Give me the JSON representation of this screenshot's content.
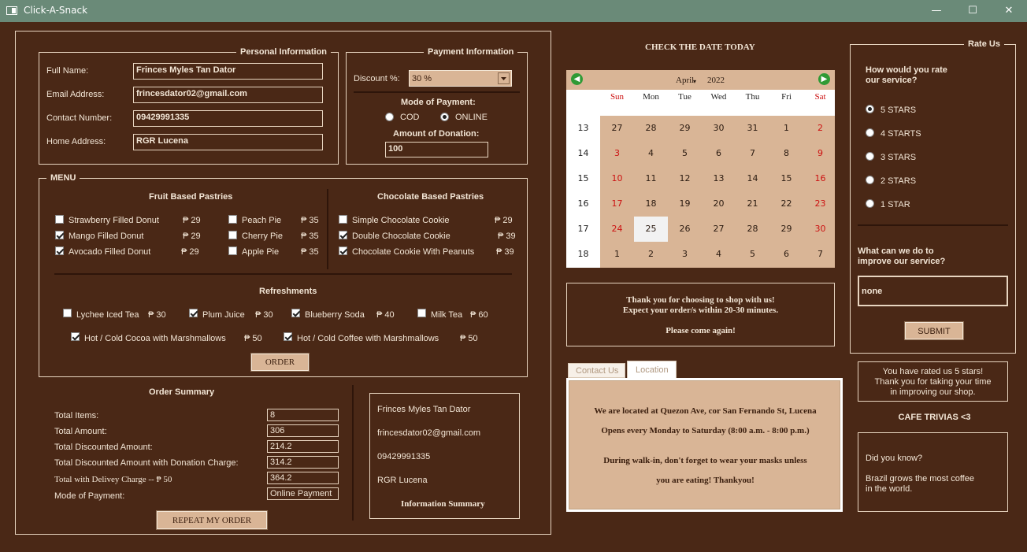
{
  "window": {
    "title": "Click-A-Snack",
    "minimize": "—",
    "maximize": "☐",
    "close": "✕"
  },
  "personal": {
    "legend": "Personal Information",
    "full_name_label": "Full Name:",
    "full_name": "Frinces Myles Tan Dator",
    "email_label": "Email Address:",
    "email": "frincesdator02@gmail.com",
    "contact_label": "Contact Number:",
    "contact": "09429991335",
    "address_label": "Home Address:",
    "address": "RGR Lucena"
  },
  "payment": {
    "legend": "Payment Information",
    "discount_label": "Discount %:",
    "discount_value": "30 %",
    "mode_label": "Mode of Payment:",
    "cod_label": "COD",
    "online_label": "ONLINE",
    "selected": "ONLINE",
    "donation_label": "Amount of Donation:",
    "donation_value": "100"
  },
  "menu": {
    "legend": "MENU",
    "currency": "₱",
    "fruit": {
      "title": "Fruit Based Pastries",
      "items": [
        {
          "name": "Strawberry Filled Donut",
          "price": "₱ 29",
          "checked": false
        },
        {
          "name": "Mango Filled Donut",
          "price": "₱ 29",
          "checked": true
        },
        {
          "name": "Avocado Filled Donut",
          "price": "₱ 29",
          "checked": true
        },
        {
          "name": "Peach Pie",
          "price": "₱ 35",
          "checked": false
        },
        {
          "name": "Cherry Pie",
          "price": "₱ 35",
          "checked": false
        },
        {
          "name": "Apple Pie",
          "price": "₱ 35",
          "checked": false
        }
      ]
    },
    "chocolate": {
      "title": "Chocolate Based Pastries",
      "items": [
        {
          "name": "Simple Chocolate Cookie",
          "price": "₱ 29",
          "checked": false
        },
        {
          "name": "Double Chocolate Cookie",
          "price": "₱ 39",
          "checked": true
        },
        {
          "name": "Chocolate Cookie With Peanuts",
          "price": "₱ 39",
          "checked": true
        }
      ]
    },
    "refreshments": {
      "title": "Refreshments",
      "items": [
        {
          "name": "Lychee Iced Tea",
          "price": "₱ 30",
          "checked": false
        },
        {
          "name": "Plum Juice",
          "price": "₱ 30",
          "checked": true
        },
        {
          "name": "Blueberry Soda",
          "price": "₱ 40",
          "checked": true
        },
        {
          "name": "Milk Tea",
          "price": "₱ 60",
          "checked": false
        },
        {
          "name": "Hot / Cold Cocoa with Marshmallows",
          "price": "₱ 50",
          "checked": true
        },
        {
          "name": "Hot / Cold Coffee with Marshmallows",
          "price": "₱ 50",
          "checked": true
        }
      ]
    },
    "order_button": "ORDER"
  },
  "summary": {
    "title": "Order Summary",
    "rows": [
      {
        "label": "Total Items:",
        "value": "8"
      },
      {
        "label": "Total Amount:",
        "value": "306"
      },
      {
        "label": "Total Discounted Amount:",
        "value": "214.2"
      },
      {
        "label": "Total Discounted Amount with Donation Charge:",
        "value": "314.2"
      },
      {
        "label": "Total with Delivey Charge  --  ₱ 50",
        "value": "364.2"
      },
      {
        "label": "Mode of Payment:",
        "value": "Online Payment"
      }
    ],
    "repeat_button": "REPEAT MY ORDER"
  },
  "info_summary": {
    "name": "Frinces Myles Tan Dator",
    "email": "frincesdator02@gmail.com",
    "contact": "09429991335",
    "address": "RGR Lucena",
    "title": "Information Summary"
  },
  "calendar": {
    "heading": "CHECK THE DATE TODAY",
    "month": "April",
    "year": "2022",
    "weekdays": [
      "Sun",
      "Mon",
      "Tue",
      "Wed",
      "Thu",
      "Fri",
      "Sat"
    ],
    "weeks": [
      "13",
      "14",
      "15",
      "16",
      "17",
      "18"
    ],
    "days": [
      [
        "27",
        "28",
        "29",
        "30",
        "31",
        "1",
        "2"
      ],
      [
        "3",
        "4",
        "5",
        "6",
        "7",
        "8",
        "9"
      ],
      [
        "10",
        "11",
        "12",
        "13",
        "14",
        "15",
        "16"
      ],
      [
        "17",
        "18",
        "19",
        "20",
        "21",
        "22",
        "23"
      ],
      [
        "24",
        "25",
        "26",
        "27",
        "28",
        "29",
        "30"
      ],
      [
        "1",
        "2",
        "3",
        "4",
        "5",
        "6",
        "7"
      ]
    ],
    "today": "25"
  },
  "thanks": {
    "line1": "Thank you for choosing to shop with us!",
    "line2": "Expect your order/s within 20-30 minutes.",
    "line3": "Please come again!"
  },
  "tabs": {
    "contact": "Contact Us",
    "location": "Location",
    "line1": "We are located at Quezon Ave, cor San Fernando St, Lucena",
    "line2": "Opens every Monday to Saturday (8:00 a.m. - 8:00 p.m.)",
    "line3": "During walk-in, don't forget to wear your masks unless",
    "line4": "you are eating! Thankyou!"
  },
  "rate": {
    "legend": "Rate Us",
    "question_1": "How would you rate",
    "question_2": "our service?",
    "options": [
      "5 STARS",
      "4 STARTS",
      "3 STARS",
      "2 STARS",
      "1 STAR"
    ],
    "selected": "5 STARS",
    "improve_1": "What can we do to",
    "improve_2": "improve our service?",
    "improve_value": "none",
    "submit": "SUBMIT",
    "result_1": "You have rated us 5 stars!",
    "result_2": "Thank you for taking your time",
    "result_3": "in improving our shop."
  },
  "trivia": {
    "title": "CAFE TRIVIAS <3",
    "line1": "Did you know?",
    "line2": "Brazil grows the most coffee",
    "line3": "in the world."
  }
}
